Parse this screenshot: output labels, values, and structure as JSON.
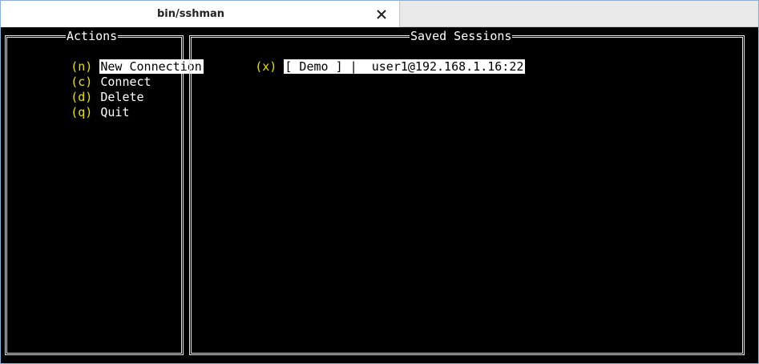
{
  "window": {
    "tab_title": "bin/sshman",
    "close_icon": "close-icon"
  },
  "actions_panel": {
    "title": "Actions",
    "items": [
      {
        "key": "(n)",
        "label": "New Connection",
        "selected": true
      },
      {
        "key": "(c)",
        "label": "Connect",
        "selected": false
      },
      {
        "key": "(d)",
        "label": "Delete",
        "selected": false
      },
      {
        "key": "(q)",
        "label": "Quit",
        "selected": false
      }
    ]
  },
  "sessions_panel": {
    "title": "Saved Sessions",
    "sessions": [
      {
        "key": "(x)",
        "label": "[ Demo ] |  user1@192.168.1.16:22",
        "selected": true
      }
    ]
  },
  "colors": {
    "key": "#e8e000",
    "border": "#e6e6e6",
    "background": "#000000"
  }
}
